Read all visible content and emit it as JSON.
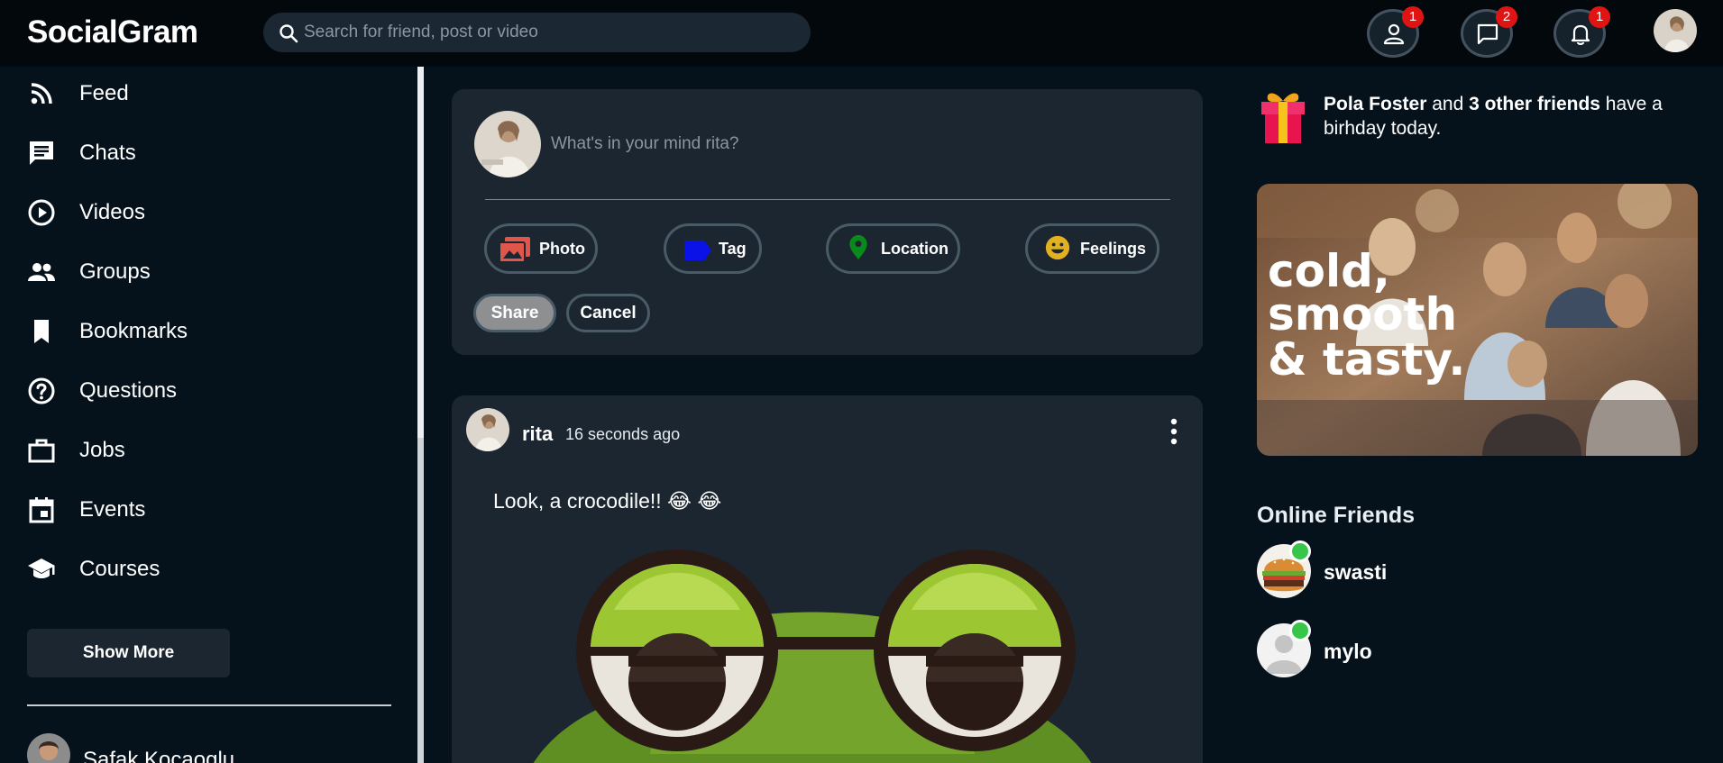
{
  "header": {
    "logo": "SocialGram",
    "search_placeholder": "Search for friend, post or video",
    "badges": {
      "friends": "1",
      "messages": "2",
      "notifications": "1"
    }
  },
  "sidebar": {
    "items": [
      {
        "label": "Feed",
        "icon": "rss-icon"
      },
      {
        "label": "Chats",
        "icon": "chat-icon"
      },
      {
        "label": "Videos",
        "icon": "play-circle-icon"
      },
      {
        "label": "Groups",
        "icon": "groups-icon"
      },
      {
        "label": "Bookmarks",
        "icon": "bookmark-icon"
      },
      {
        "label": "Questions",
        "icon": "help-circle-icon"
      },
      {
        "label": "Jobs",
        "icon": "briefcase-icon"
      },
      {
        "label": "Events",
        "icon": "calendar-icon"
      },
      {
        "label": "Courses",
        "icon": "school-icon"
      }
    ],
    "show_more": "Show More",
    "friend_name": "Safak Kocaoglu"
  },
  "share": {
    "placeholder": "What's in your mind rita?",
    "options": {
      "photo": "Photo",
      "tag": "Tag",
      "location": "Location",
      "feelings": "Feelings"
    },
    "share_button": "Share",
    "cancel_button": "Cancel"
  },
  "post": {
    "username": "rita",
    "time": "16 seconds ago",
    "text": "Look, a crocodile!! 😂 😂"
  },
  "rightbar": {
    "birthday_name": "Pola Foster",
    "birthday_and": " and ",
    "birthday_others": "3 other friends",
    "birthday_rest": " have a birhday today.",
    "ad_text_1": "cold,",
    "ad_text_2": "smooth",
    "ad_text_3": "& tasty.",
    "online_title": "Online Friends",
    "online_friends": [
      {
        "name": "swasti"
      },
      {
        "name": "mylo"
      }
    ]
  },
  "colors": {
    "background": "#06121b",
    "card": "#1b2631",
    "badge": "#e11414",
    "online": "#37c64a",
    "photo_icon": "#e0564a",
    "tag_icon": "#0a12e8",
    "location_icon": "#0a8a1a",
    "feelings_icon": "#e3b020"
  }
}
